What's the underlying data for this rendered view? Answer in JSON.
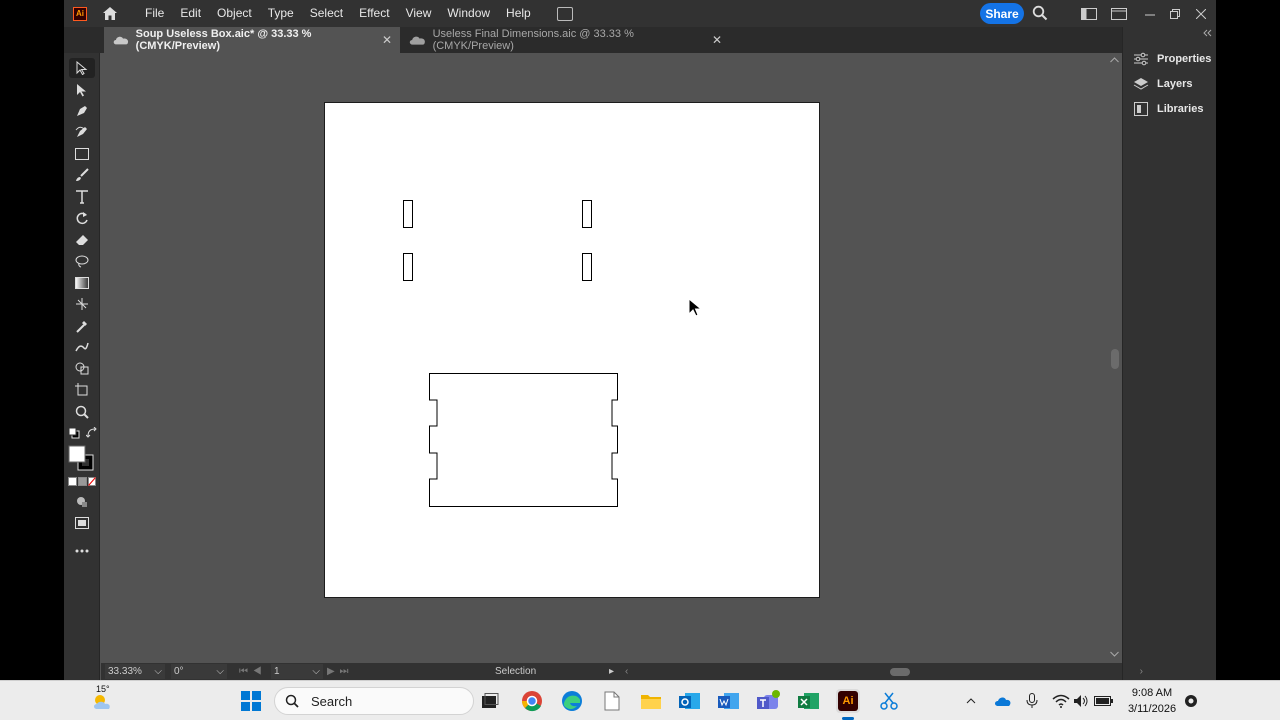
{
  "menubar": {
    "logo": "Ai",
    "items": [
      "File",
      "Edit",
      "Object",
      "Type",
      "Select",
      "Effect",
      "View",
      "Window",
      "Help"
    ],
    "share_label": "Share"
  },
  "tabs": [
    {
      "label": "Soup Useless Box.aic* @ 33.33 % (CMYK/Preview)",
      "active": true
    },
    {
      "label": "Useless Final Dimensions.aic @ 33.33 % (CMYK/Preview)",
      "active": false
    }
  ],
  "right_panel": {
    "items": [
      {
        "label": "Properties",
        "icon": "properties-icon"
      },
      {
        "label": "Layers",
        "icon": "layers-icon"
      },
      {
        "label": "Libraries",
        "icon": "libraries-icon"
      }
    ]
  },
  "statusbar": {
    "zoom": "33.33%",
    "rotation": "0°",
    "artboard": "1",
    "tool": "Selection"
  },
  "taskbar": {
    "weather": "15°",
    "search_label": "Search",
    "time": "9:08 AM",
    "date": "3/11/2026"
  },
  "colors": {
    "accent": "#1473e6",
    "workspace": "#535353",
    "chrome": "#323232"
  }
}
